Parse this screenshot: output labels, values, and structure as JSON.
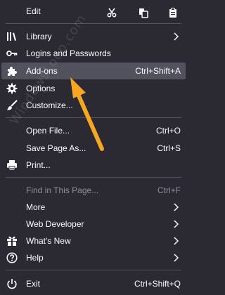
{
  "menu": {
    "edit": {
      "label": "Edit",
      "buttons": [
        {
          "icon": "cut-icon"
        },
        {
          "icon": "copy-icon"
        },
        {
          "icon": "paste-icon"
        }
      ]
    },
    "library": {
      "label": "Library",
      "icon": "library-icon"
    },
    "logins": {
      "label": "Logins and Passwords",
      "icon": "key-icon"
    },
    "addons": {
      "label": "Add-ons",
      "shortcut": "Ctrl+Shift+A",
      "icon": "puzzle-icon"
    },
    "options": {
      "label": "Options",
      "icon": "gear-icon"
    },
    "customize": {
      "label": "Customize...",
      "icon": "brush-icon"
    },
    "open_file": {
      "label": "Open File...",
      "shortcut": "Ctrl+O"
    },
    "save_page": {
      "label": "Save Page As...",
      "shortcut": "Ctrl+S"
    },
    "print": {
      "label": "Print...",
      "icon": "printer-icon"
    },
    "find": {
      "label": "Find in This Page...",
      "shortcut": "Ctrl+F"
    },
    "more": {
      "label": "More"
    },
    "web_dev": {
      "label": "Web Developer"
    },
    "whats_new": {
      "label": "What's New",
      "icon": "gift-icon"
    },
    "help": {
      "label": "Help",
      "icon": "help-icon"
    },
    "exit": {
      "label": "Exit",
      "shortcut": "Ctrl+Shift+Q",
      "icon": "power-icon"
    }
  },
  "overlay": {
    "watermark_text": "WindowsLoop.com",
    "arrow_color": "#f5a623"
  },
  "colors": {
    "background": "#2b2a33",
    "hover": "#52525e",
    "text": "#fbfbfe",
    "disabled_text": "#8f8f9d",
    "separator": "#52525e"
  }
}
